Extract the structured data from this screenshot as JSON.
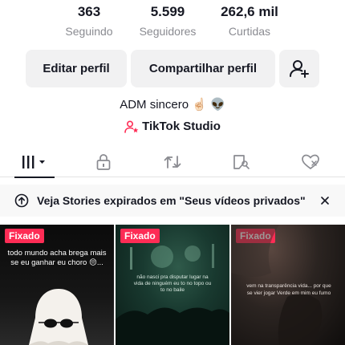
{
  "stats": [
    {
      "value": "363",
      "label": "Seguindo"
    },
    {
      "value": "5.599",
      "label": "Seguidores"
    },
    {
      "value": "262,6 mil",
      "label": "Curtidas"
    }
  ],
  "buttons": {
    "edit": "Editar perfil",
    "share": "Compartilhar perfil"
  },
  "bio": "ADM sincero ☝🏻 👽",
  "studio_link": "TikTok Studio",
  "tabs": [
    "videos-grid-icon",
    "lock-icon",
    "repost-icon",
    "tagged-icon",
    "liked-icon"
  ],
  "banner": {
    "text": "Veja Stories expirados em \"Seus vídeos privados\""
  },
  "videos": [
    {
      "pin_label": "Fixado",
      "caption": "todo mundo acha brega mais se eu ganhar eu choro 😔..."
    },
    {
      "pin_label": "Fixado",
      "caption": "não nasci pra disputar lugar na vida de ninguém eu to no topo ou to no baile"
    },
    {
      "pin_label": "Fixado",
      "caption": "vem na transparência vida... por que se vier jogar Verde em mim eu fumo"
    }
  ],
  "colors": {
    "accent": "#fe2c55",
    "text": "#161823",
    "muted": "#8a8b91",
    "button_bg": "#f1f1f2"
  }
}
